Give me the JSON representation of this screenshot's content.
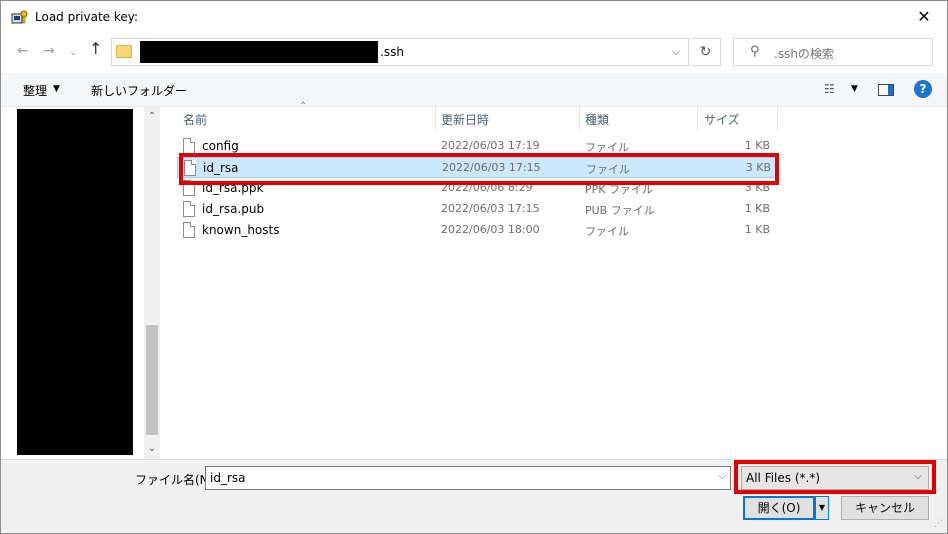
{
  "window": {
    "title": "Load private key:"
  },
  "address": {
    "current_folder": ".ssh",
    "search_placeholder": ".sshの検索"
  },
  "toolbar": {
    "organize_label": "整理",
    "new_folder_label": "新しいフォルダー"
  },
  "columns": {
    "name": "名前",
    "modified": "更新日時",
    "type": "種類",
    "size": "サイズ"
  },
  "files": [
    {
      "name": "config",
      "modified": "2022/06/03 17:19",
      "type": "ファイル",
      "size": "1 KB",
      "selected": false
    },
    {
      "name": "id_rsa",
      "modified": "2022/06/03 17:15",
      "type": "ファイル",
      "size": "3 KB",
      "selected": true
    },
    {
      "name": "id_rsa.ppk",
      "modified": "2022/06/06 8:29",
      "type": "PPK ファイル",
      "size": "3 KB",
      "selected": false
    },
    {
      "name": "id_rsa.pub",
      "modified": "2022/06/03 17:15",
      "type": "PUB ファイル",
      "size": "1 KB",
      "selected": false
    },
    {
      "name": "known_hosts",
      "modified": "2022/06/03 18:00",
      "type": "ファイル",
      "size": "1 KB",
      "selected": false
    }
  ],
  "bottom": {
    "filename_label": "ファイル名(N):",
    "filename_value": "id_rsa",
    "filter_value": "All Files (*.*)",
    "open_label": "開く(O)",
    "cancel_label": "キャンセル"
  },
  "colors": {
    "highlight": "#e00000",
    "selection": "#cce8ff",
    "accent": "#0078d7"
  }
}
